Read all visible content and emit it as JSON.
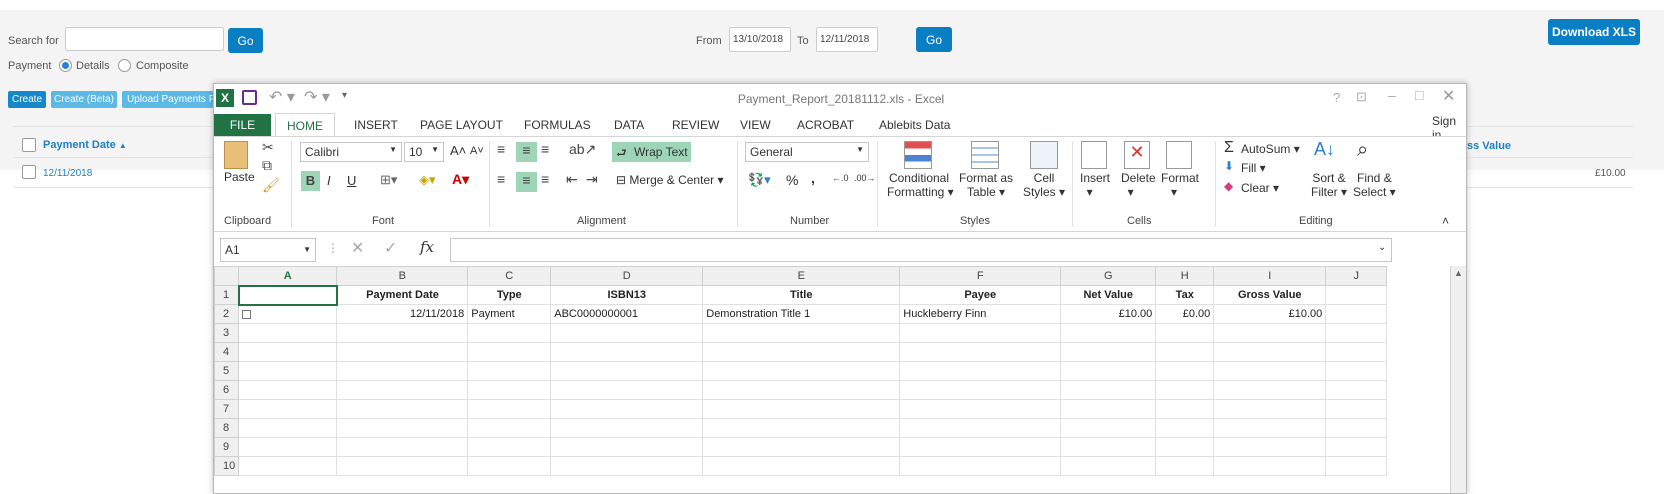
{
  "search": {
    "label": "Search for",
    "value": "",
    "go": "Go"
  },
  "dates": {
    "from_label": "From",
    "from": "13/10/2018",
    "to_label": "To",
    "to": "12/11/2018",
    "go": "Go"
  },
  "download": "Download XLS",
  "payment": {
    "label": "Payment",
    "details": "Details",
    "composite": "Composite"
  },
  "actions": {
    "create": "Create",
    "create_beta": "Create (Beta)",
    "upload": "Upload Payments Fi"
  },
  "list": {
    "col_payment_date": "Payment Date",
    "sort_arrow": "▲",
    "col_gross": "ss Value",
    "row_date": "12/11/2018",
    "row_gross": "£10.00"
  },
  "excel": {
    "title": "Payment_Report_20181112.xls - Excel",
    "help": "?",
    "signin": "Sign in",
    "tabs": {
      "file": "FILE",
      "home": "HOME",
      "insert": "INSERT",
      "page_layout": "PAGE LAYOUT",
      "formulas": "FORMULAS",
      "data": "DATA",
      "review": "REVIEW",
      "view": "VIEW",
      "acrobat": "ACROBAT",
      "ablebits": "Ablebits Data"
    },
    "ribbon": {
      "paste": "Paste",
      "clipboard": "Clipboard",
      "font_name": "Calibri",
      "font_size": "10",
      "font": "Font",
      "wrap_text": "Wrap Text",
      "merge_center": "Merge & Center",
      "alignment": "Alignment",
      "number_format": "General",
      "number": "Number",
      "cond_fmt_1": "Conditional",
      "cond_fmt_2": "Formatting ▾",
      "fmt_table_1": "Format as",
      "fmt_table_2": "Table ▾",
      "cell_styles_1": "Cell",
      "cell_styles_2": "Styles ▾",
      "styles": "Styles",
      "insert": "Insert",
      "delete": "Delete",
      "format": "Format",
      "cells": "Cells",
      "autosum": "AutoSum",
      "fill": "Fill ▾",
      "clear": "Clear ▾",
      "sort_1": "Sort &",
      "sort_2": "Filter ▾",
      "find_1": "Find &",
      "find_2": "Select ▾",
      "editing": "Editing",
      "bold": "B",
      "italic": "I",
      "underline": "U",
      "percent": "%",
      "comma": ","
    },
    "name_box": "A1",
    "fx": "fx",
    "columns": [
      "A",
      "B",
      "C",
      "D",
      "E",
      "F",
      "G",
      "H",
      "I",
      "J"
    ],
    "header_row": [
      "",
      "Payment Date",
      "Type",
      "ISBN13",
      "Title",
      "Payee",
      "Net Value",
      "Tax",
      "Gross Value",
      ""
    ],
    "data_row": [
      "",
      "12/11/2018",
      "Payment",
      "ABC0000000001",
      "Demonstration Title 1",
      "Huckleberry Finn",
      "£10.00",
      "£0.00",
      "£10.00",
      ""
    ],
    "row_numbers": [
      "1",
      "2",
      "3",
      "4",
      "5",
      "6",
      "7",
      "8",
      "9",
      "10"
    ]
  }
}
